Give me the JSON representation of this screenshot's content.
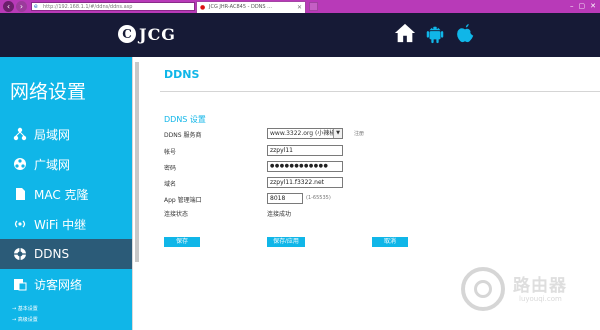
{
  "browser": {
    "url": "http://192.168.1.1/#/ddns/ddns.asp",
    "tab_title": "JCG JHR-AC845 - DDNS ...",
    "new_tab": "",
    "win_min": "–",
    "win_max": "▢",
    "win_close": "✕"
  },
  "header": {
    "logo_mark": "C",
    "logo_text": "JCG",
    "icons": [
      "home-icon",
      "android-icon",
      "apple-icon"
    ]
  },
  "sidebar": {
    "title": "网络设置",
    "items": [
      {
        "label": "局域网",
        "icon": "lan-icon",
        "active": false
      },
      {
        "label": "广域网",
        "icon": "wan-icon",
        "active": false
      },
      {
        "label": "MAC 克隆",
        "icon": "mac-clone-icon",
        "active": false
      },
      {
        "label": "WiFi 中继",
        "icon": "wifi-relay-icon",
        "active": false
      },
      {
        "label": "DDNS",
        "icon": "ddns-icon",
        "active": true
      },
      {
        "label": "访客网络",
        "icon": "guest-network-icon",
        "active": false
      }
    ],
    "sub_items": [
      "基本设置",
      "高级设置"
    ]
  },
  "main": {
    "title": "DDNS",
    "section_title": "DDNS 设置",
    "fields": {
      "provider": {
        "label": "DDNS 服务商",
        "value": "www.3322.org (小辣椒)",
        "link": "注册"
      },
      "account": {
        "label": "帐号",
        "value": "zzpyl11"
      },
      "password": {
        "label": "密码",
        "value": "●●●●●●●●●●●●"
      },
      "domain": {
        "label": "域名",
        "value": "zzpyl11.f3322.net"
      },
      "app_port": {
        "label": "App 管理端口",
        "value": "8018",
        "hint": "(1-65535)"
      },
      "status": {
        "label": "连接状态",
        "value": "连接成功"
      }
    },
    "buttons": {
      "save": "保存",
      "save_apply": "保存/应用",
      "cancel": "取消"
    }
  },
  "watermark": {
    "text": "路由器",
    "sub": "luyouqi.com"
  },
  "colors": {
    "accent": "#10b6e8",
    "header_bg": "#161a36",
    "browser_bar": "#b83ab8",
    "active_item": "#2b5b78"
  }
}
